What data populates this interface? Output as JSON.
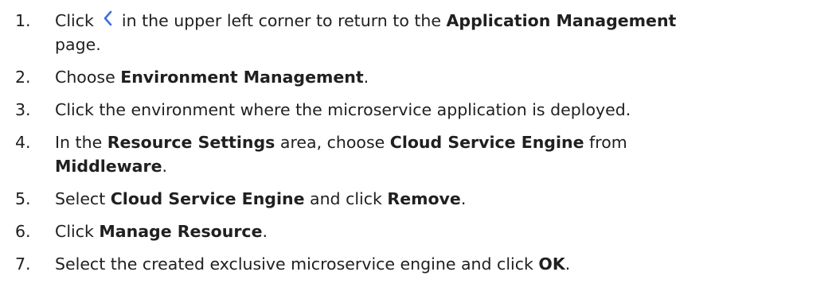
{
  "steps": [
    {
      "number": "1.",
      "parts": {
        "t1": "Click",
        "icon": "chevron-left-icon",
        "t2": " in the upper left corner to return to the ",
        "b1": "Application Management",
        "t3": " page."
      }
    },
    {
      "number": "2.",
      "parts": {
        "t1": "Choose ",
        "b1": "Environment Management",
        "t2": "."
      }
    },
    {
      "number": "3.",
      "parts": {
        "t1": "Click the environment where the microservice application is deployed."
      }
    },
    {
      "number": "4.",
      "parts": {
        "t1": "In the ",
        "b1": "Resource Settings",
        "t2": " area, choose ",
        "b2": "Cloud Service Engine",
        "t3": " from ",
        "b3": "Middleware",
        "t4": "."
      }
    },
    {
      "number": "5.",
      "parts": {
        "t1": "Select ",
        "b1": "Cloud Service Engine",
        "t2": " and click ",
        "b2": "Remove",
        "t3": "."
      }
    },
    {
      "number": "6.",
      "parts": {
        "t1": "Click ",
        "b1": "Manage Resource",
        "t2": "."
      }
    },
    {
      "number": "7.",
      "parts": {
        "t1": "Select the created exclusive microservice engine and click ",
        "b1": "OK",
        "t2": "."
      }
    }
  ],
  "colors": {
    "text": "#202020",
    "icon": "#3b6ee0"
  }
}
